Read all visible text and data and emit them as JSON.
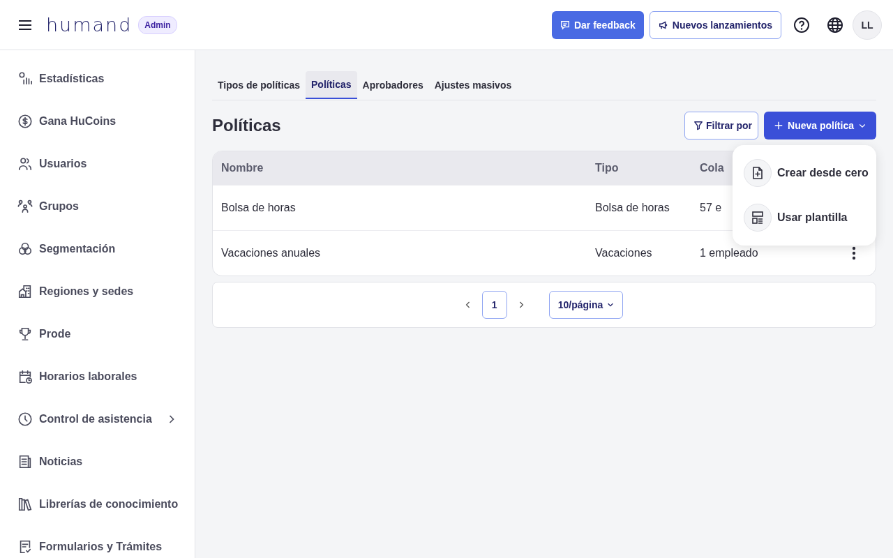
{
  "header": {
    "logo": "humand",
    "badge": "Admin",
    "feedback_button": "Dar feedback",
    "releases_button": "Nuevos lanzamientos",
    "avatar": "LL"
  },
  "sidebar": {
    "items": [
      {
        "label": "Estadísticas",
        "expandable": false
      },
      {
        "label": "Gana HuCoins",
        "expandable": false
      },
      {
        "label": "Usuarios",
        "expandable": false
      },
      {
        "label": "Grupos",
        "expandable": false
      },
      {
        "label": "Segmentación",
        "expandable": false
      },
      {
        "label": "Regiones y sedes",
        "expandable": false
      },
      {
        "label": "Prode",
        "expandable": false
      },
      {
        "label": "Horarios laborales",
        "expandable": false
      },
      {
        "label": "Control de asistencia",
        "expandable": true
      },
      {
        "label": "Noticias",
        "expandable": false
      },
      {
        "label": "Librerías de conocimiento",
        "expandable": false
      },
      {
        "label": "Formularios y Trámites",
        "expandable": false
      }
    ]
  },
  "tabs": [
    {
      "label": "Tipos de políticas",
      "selected": false
    },
    {
      "label": "Políticas",
      "selected": true
    },
    {
      "label": "Aprobadores",
      "selected": false
    },
    {
      "label": "Ajustes masivos",
      "selected": false
    }
  ],
  "page_title": "Políticas",
  "filter_button": "Filtrar por",
  "new_button": "Nueva política",
  "table": {
    "columns": [
      "Nombre",
      "Tipo",
      "Cola"
    ],
    "rows": [
      {
        "cells": [
          "Bolsa de horas",
          "Bolsa de horas",
          "57 e"
        ]
      },
      {
        "cells": [
          "Vacaciones anuales",
          "Vacaciones",
          "1 empleado"
        ]
      }
    ]
  },
  "pagination": {
    "page": "1",
    "page_size": "10/página"
  },
  "menu": {
    "items": [
      {
        "label": "Crear desde cero"
      },
      {
        "label": "Usar plantilla"
      }
    ]
  }
}
